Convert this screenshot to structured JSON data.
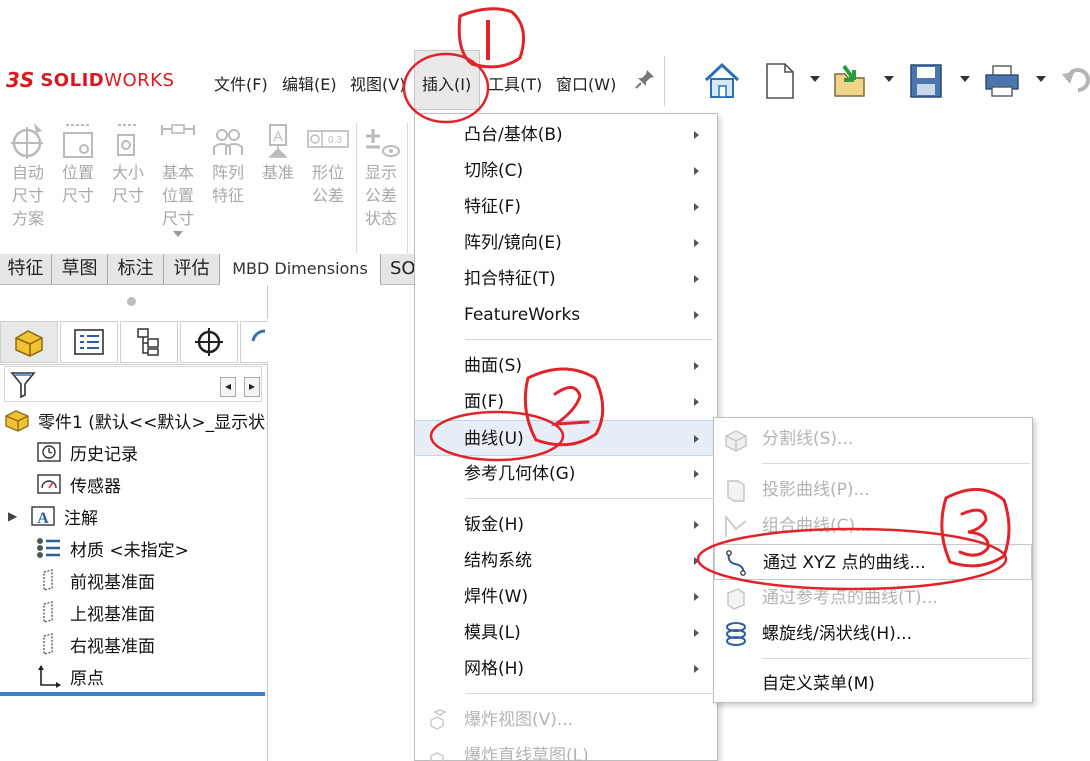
{
  "logo": {
    "prefix": "3S",
    "brand_bold": "SOLID",
    "brand_light": "WORKS",
    "color": "#d81920"
  },
  "menubar": {
    "items": [
      "文件(F)",
      "编辑(E)",
      "视图(V)",
      "插入(I)",
      "工具(T)",
      "窗口(W)"
    ],
    "active_index": 3
  },
  "toolbar": {
    "icons": [
      "home-icon",
      "new-document-icon",
      "open-folder-icon",
      "save-icon",
      "print-icon",
      "undo-icon"
    ]
  },
  "command_manager": {
    "buttons": [
      {
        "label": [
          "自动",
          "尺寸",
          "方案"
        ],
        "icon": "auto-dimension-icon"
      },
      {
        "label": [
          "位置",
          "尺寸"
        ],
        "icon": "location-dimension-icon"
      },
      {
        "label": [
          "大小",
          "尺寸"
        ],
        "icon": "size-dimension-icon"
      },
      {
        "label": [
          "基本",
          "位置",
          "尺寸"
        ],
        "icon": "basic-location-dimension-icon"
      },
      {
        "label": [
          "阵列",
          "特征"
        ],
        "icon": "pattern-feature-icon"
      },
      {
        "label": [
          "基准"
        ],
        "icon": "datum-icon"
      },
      {
        "label": [
          "形位",
          "公差"
        ],
        "icon": "geometric-tolerance-icon"
      },
      {
        "label": [
          "显示",
          "公差",
          "状态"
        ],
        "icon": "show-tolerance-status-icon"
      }
    ]
  },
  "tabs": [
    "特征",
    "草图",
    "标注",
    "评估",
    "MBD Dimensions",
    "SO"
  ],
  "active_tab": 4,
  "feature_tree": {
    "root": "零件1  (默认<<默认>_显示状",
    "items": [
      {
        "label": "历史记录",
        "icon": "history-icon"
      },
      {
        "label": "传感器",
        "icon": "sensor-icon"
      },
      {
        "label": "注解",
        "icon": "annotation-icon",
        "expandable": true
      },
      {
        "label": "材质 <未指定>",
        "icon": "material-icon"
      },
      {
        "label": "前视基准面",
        "icon": "plane-icon"
      },
      {
        "label": "上视基准面",
        "icon": "plane-icon"
      },
      {
        "label": "右视基准面",
        "icon": "plane-icon"
      },
      {
        "label": "原点",
        "icon": "origin-icon"
      }
    ]
  },
  "insert_menu": {
    "items": [
      {
        "label": "凸台/基体(B)",
        "submenu": true
      },
      {
        "label": "切除(C)",
        "submenu": true
      },
      {
        "label": "特征(F)",
        "submenu": true
      },
      {
        "label": "阵列/镜向(E)",
        "submenu": true
      },
      {
        "label": "扣合特征(T)",
        "submenu": true
      },
      {
        "label": "FeatureWorks",
        "submenu": true
      },
      {
        "label": "曲面(S)",
        "submenu": true
      },
      {
        "label": "面(F)",
        "submenu": true
      },
      {
        "label": "曲线(U)",
        "submenu": true,
        "highlighted": true
      },
      {
        "label": "参考几何体(G)",
        "submenu": true
      },
      {
        "label": "钣金(H)",
        "submenu": true
      },
      {
        "label": "结构系统",
        "submenu": true
      },
      {
        "label": "焊件(W)",
        "submenu": true
      },
      {
        "label": "模具(L)",
        "submenu": true
      },
      {
        "label": "网格(H)",
        "submenu": true
      },
      {
        "label": "爆炸视图(V)...",
        "disabled": true,
        "icon": "explode-view-icon"
      },
      {
        "label": "爆炸直线草图(L)",
        "disabled": true,
        "icon": "explode-line-sketch-icon"
      }
    ]
  },
  "curve_submenu": {
    "items": [
      {
        "label": "分割线(S)...",
        "disabled": true,
        "icon": "split-line-icon"
      },
      {
        "label": "投影曲线(P)...",
        "disabled": true,
        "icon": "projected-curve-icon"
      },
      {
        "label": "组合曲线(C)...",
        "disabled": true,
        "icon": "composite-curve-icon"
      },
      {
        "label": "通过 XYZ 点的曲线...",
        "highlighted": true,
        "icon": "curve-through-xyz-icon"
      },
      {
        "label": "通过参考点的曲线(T)...",
        "disabled": true,
        "icon": "curve-through-reference-points-icon"
      },
      {
        "label": "螺旋线/涡状线(H)...",
        "icon": "helix-spiral-icon"
      },
      {
        "label": "自定义菜单(M)"
      }
    ]
  },
  "annotations": {
    "color": "#e0242a",
    "steps": [
      "1",
      "2",
      "3"
    ]
  }
}
